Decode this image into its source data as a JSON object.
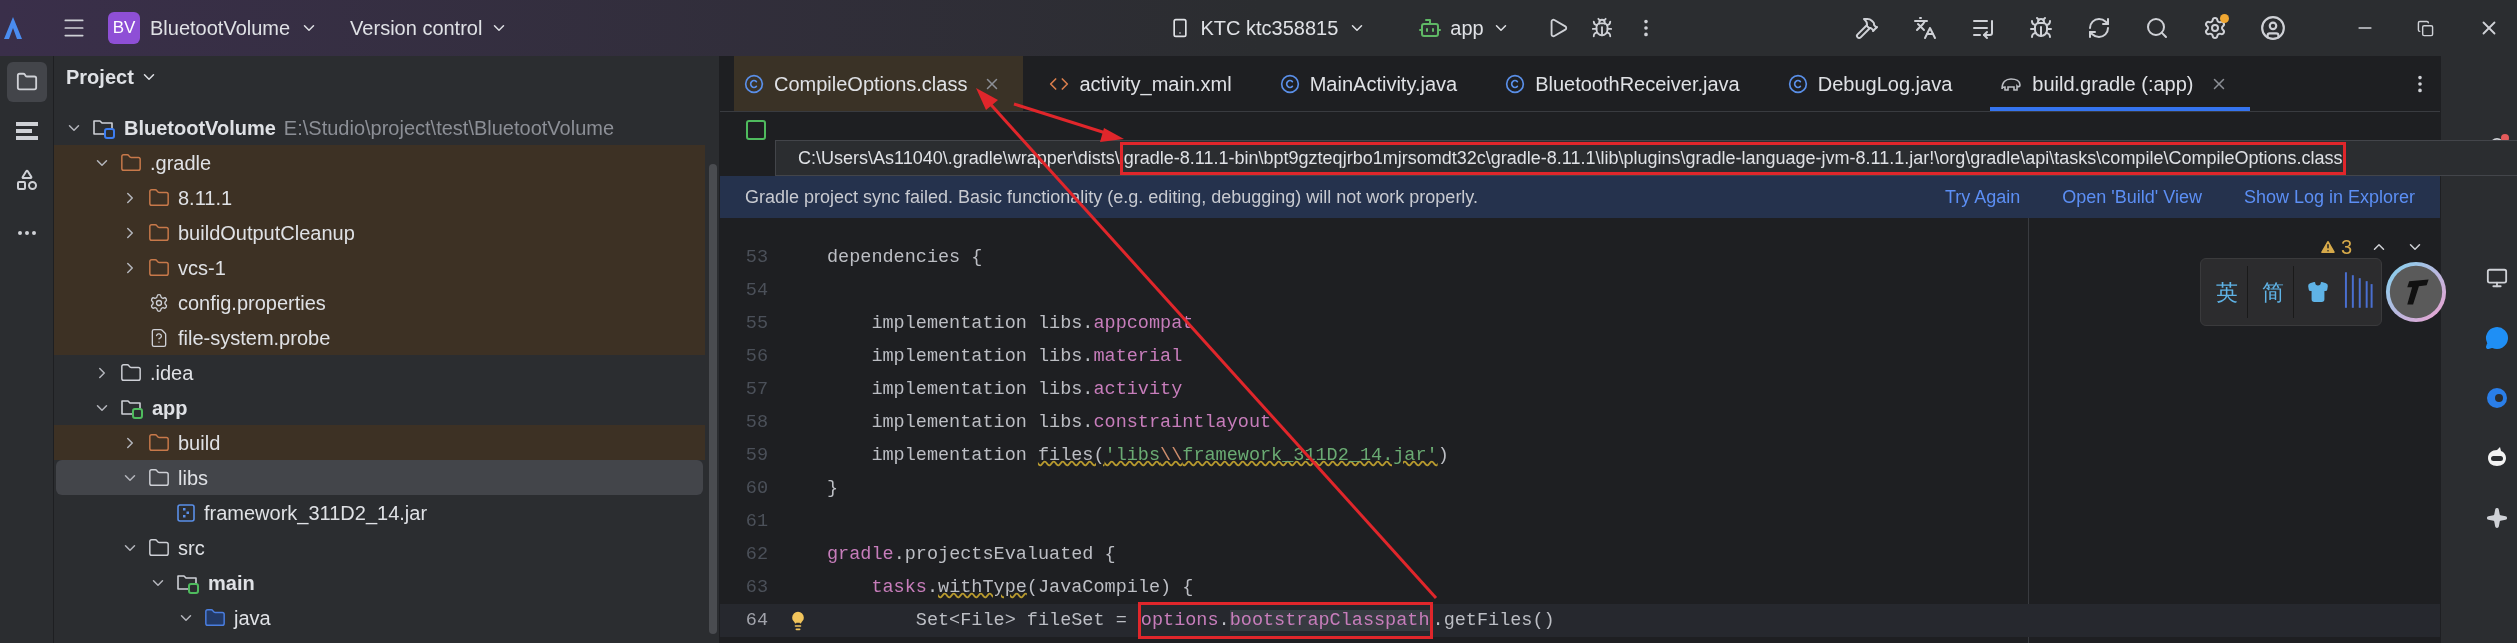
{
  "title_bar": {
    "project_badge": "BV",
    "project": "BluetootVolume",
    "vcs": "Version control",
    "device": "KTC ktc358815",
    "run_config": "app"
  },
  "project_panel": {
    "title": "Project",
    "tree": [
      {
        "name": "BluetootVolume",
        "path": "E:\\Studio\\project\\test\\BluetootVolume",
        "kind": "project",
        "expanded": true,
        "excluded": false,
        "selected": false,
        "children": [
          {
            "name": ".gradle",
            "kind": "folder",
            "expanded": true,
            "excluded": true,
            "selected": false,
            "children": [
              {
                "name": "8.11.1",
                "kind": "folder",
                "expanded": false,
                "excluded": true,
                "selected": false
              },
              {
                "name": "buildOutputCleanup",
                "kind": "folder",
                "expanded": false,
                "excluded": true,
                "selected": false
              },
              {
                "name": "vcs-1",
                "kind": "folder",
                "expanded": false,
                "excluded": true,
                "selected": false
              },
              {
                "name": "config.properties",
                "kind": "settings",
                "excluded": true,
                "selected": false
              },
              {
                "name": "file-system.probe",
                "kind": "unknown",
                "excluded": true,
                "selected": false
              }
            ]
          },
          {
            "name": ".idea",
            "kind": "folder",
            "expanded": false,
            "excluded": false,
            "selected": false
          },
          {
            "name": "app",
            "kind": "module",
            "expanded": true,
            "excluded": false,
            "selected": false,
            "children": [
              {
                "name": "build",
                "kind": "folder",
                "expanded": false,
                "excluded": true,
                "selected": false
              },
              {
                "name": "libs",
                "kind": "folder",
                "expanded": true,
                "excluded": false,
                "selected": true,
                "children": [
                  {
                    "name": "framework_311D2_14.jar",
                    "kind": "jar",
                    "excluded": false,
                    "selected": false
                  }
                ]
              },
              {
                "name": "src",
                "kind": "folder",
                "expanded": true,
                "excluded": false,
                "selected": false,
                "children": [
                  {
                    "name": "main",
                    "kind": "module",
                    "expanded": true,
                    "excluded": false,
                    "selected": false,
                    "children": [
                      {
                        "name": "java",
                        "kind": "source",
                        "expanded": true,
                        "excluded": false,
                        "selected": false
                      }
                    ]
                  }
                ]
              }
            ]
          }
        ]
      }
    ]
  },
  "tabs": [
    {
      "label": "CompileOptions.class",
      "kind": "class",
      "selected": false,
      "closable": true
    },
    {
      "label": "activity_main.xml",
      "kind": "xml",
      "selected": false,
      "closable": false
    },
    {
      "label": "MainActivity.java",
      "kind": "java",
      "selected": false,
      "closable": false
    },
    {
      "label": "BluetoothReceiver.java",
      "kind": "java",
      "selected": false,
      "closable": false
    },
    {
      "label": "DebugLog.java",
      "kind": "java",
      "selected": false,
      "closable": false
    },
    {
      "label": "build.gradle (:app)",
      "kind": "gradle",
      "selected": true,
      "closable": true
    }
  ],
  "tooltip": {
    "parts": [
      {
        "text": "C:\\Users\\As11040\\.gradle\\wrapper\\dists\\",
        "kind": "plain"
      },
      {
        "text": "gradle-8.11.1-bin\\bpt9gzteqjrbo1mjrsomdt32c\\gradle-8.11.1\\lib\\plugins\\gradle-language-jvm-8.11.1.jar!\\org\\gradle\\api\\tasks\\compile\\CompileOptions.class",
        "kind": "box"
      }
    ]
  },
  "banner": {
    "message": "Gradle project sync failed. Basic functionality (e.g. editing, debugging) will not work properly.",
    "actions": [
      "Try Again",
      "Open 'Build' View",
      "Show Log in Explorer"
    ]
  },
  "editor": {
    "warnings": "3",
    "lines": [
      {
        "number": "53",
        "current": false,
        "tokens": [
          {
            "text": "dependencies {",
            "kind": "plain"
          }
        ]
      },
      {
        "number": "54",
        "current": false
      },
      {
        "number": "55",
        "current": false,
        "tokens": [
          {
            "text": "    implementation libs.",
            "kind": "plain"
          },
          {
            "text": "appcompat",
            "kind": "member"
          }
        ]
      },
      {
        "number": "56",
        "current": false,
        "tokens": [
          {
            "text": "    implementation libs.",
            "kind": "plain"
          },
          {
            "text": "material",
            "kind": "member"
          }
        ]
      },
      {
        "number": "57",
        "current": false,
        "tokens": [
          {
            "text": "    implementation libs.",
            "kind": "plain"
          },
          {
            "text": "activity",
            "kind": "member"
          }
        ]
      },
      {
        "number": "58",
        "current": false,
        "tokens": [
          {
            "text": "    implementation libs.",
            "kind": "plain"
          },
          {
            "text": "constraintlayout",
            "kind": "member"
          }
        ]
      },
      {
        "number": "59",
        "current": false,
        "tokens": [
          {
            "text": "    implementation ",
            "kind": "plain"
          },
          {
            "text": "files(",
            "kind": "plain_warn"
          },
          {
            "text": "'libs",
            "kind": "string_warn"
          },
          {
            "text": "\\\\",
            "kind": "escape_warn"
          },
          {
            "text": "framework_311D2_14.jar'",
            "kind": "string_warn"
          },
          {
            "text": ")",
            "kind": "plain"
          }
        ]
      },
      {
        "number": "60",
        "current": false,
        "tokens": [
          {
            "text": "}",
            "kind": "plain"
          }
        ]
      },
      {
        "number": "61",
        "current": false
      },
      {
        "number": "62",
        "current": false,
        "tokens": [
          {
            "text": "gradle",
            "kind": "member"
          },
          {
            "text": ".projectsEvaluated {",
            "kind": "plain"
          }
        ]
      },
      {
        "number": "63",
        "current": false,
        "tokens": [
          {
            "text": "    tasks",
            "kind": "member"
          },
          {
            "text": ".",
            "kind": "plain"
          },
          {
            "text": "withType",
            "kind": "plain_warn"
          },
          {
            "text": "(JavaCompile) {",
            "kind": "plain"
          }
        ]
      },
      {
        "number": "64",
        "current": true,
        "tokens": [
          {
            "text": "        Set<File> fileSet = ",
            "kind": "plain"
          },
          {
            "kind": "box",
            "tokens": [
              {
                "text": "options",
                "kind": "member"
              },
              {
                "text": ".",
                "kind": "plain"
              },
              {
                "text": "bootstrapClasspath",
                "kind": "member_hl"
              }
            ]
          },
          {
            "text": ".getFiles()",
            "kind": "plain"
          }
        ]
      }
    ]
  },
  "ime_toolbar": {
    "buttons": [
      "英",
      "简"
    ]
  }
}
